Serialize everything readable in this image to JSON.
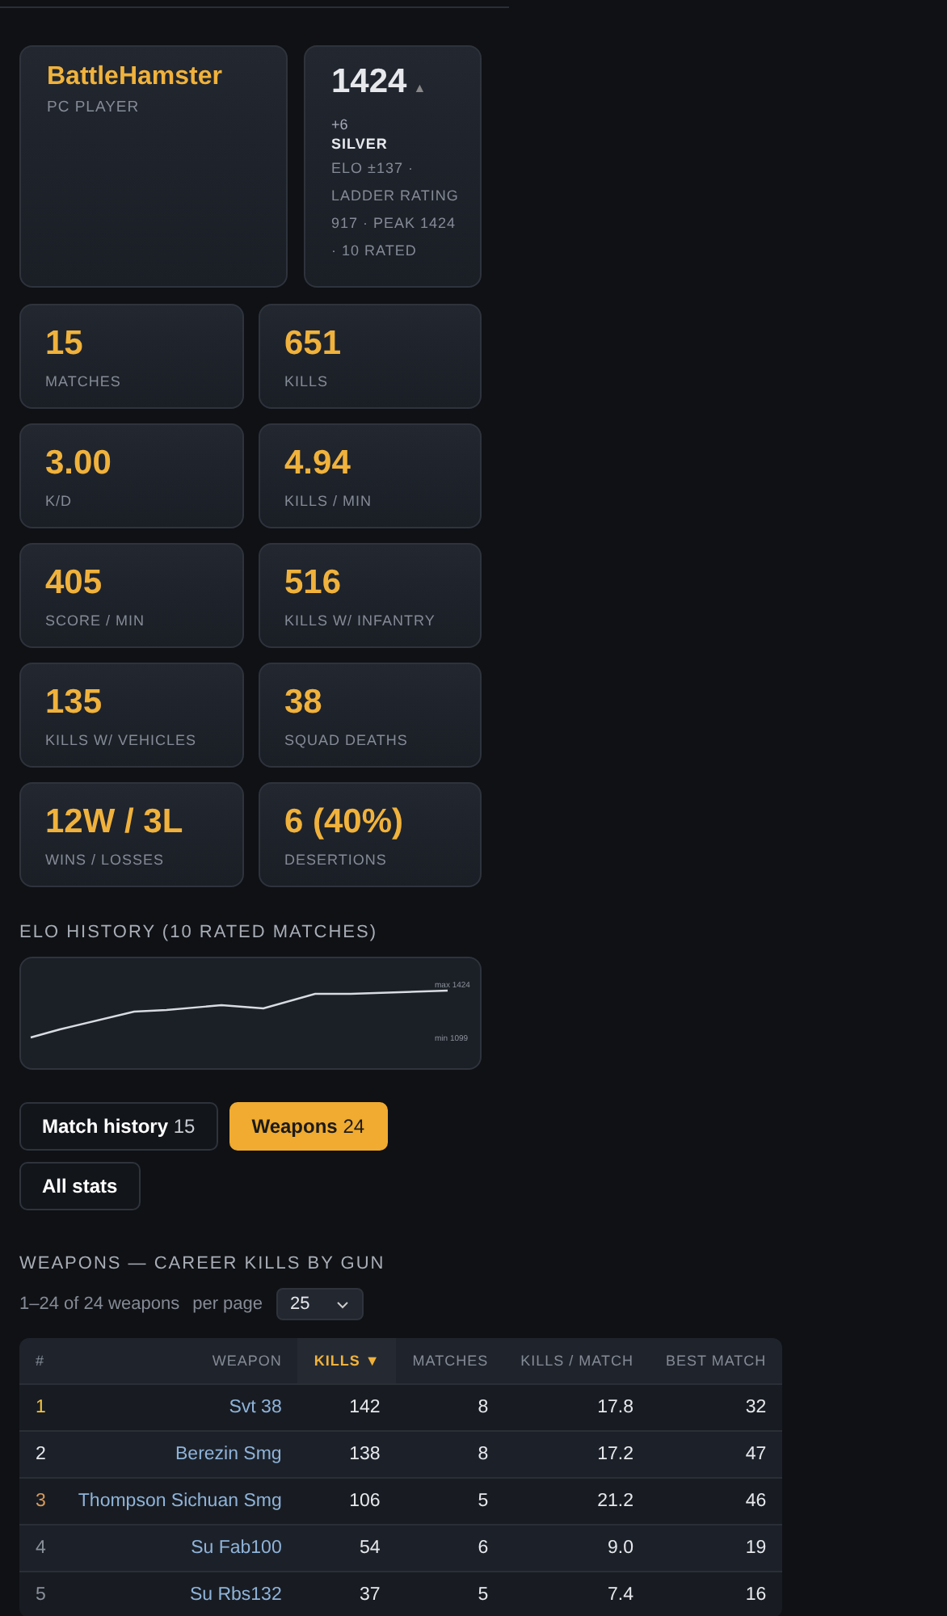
{
  "profile": {
    "name": "BattleHamster",
    "platform": "PC PLAYER"
  },
  "rating": {
    "elo": "1424",
    "trend_icon": "▲",
    "change": "+6",
    "tier": "SILVER",
    "details": "ELO ±137 · LADDER RATING 917 · PEAK 1424 · 10 RATED"
  },
  "stats": [
    {
      "value": "15",
      "label": "MATCHES"
    },
    {
      "value": "651",
      "label": "KILLS"
    },
    {
      "value": "3.00",
      "label": "K/D"
    },
    {
      "value": "4.94",
      "label": "KILLS / MIN"
    },
    {
      "value": "405",
      "label": "SCORE / MIN"
    },
    {
      "value": "516",
      "label": "KILLS W/ INFANTRY"
    },
    {
      "value": "135",
      "label": "KILLS W/ VEHICLES"
    },
    {
      "value": "38",
      "label": "SQUAD DEATHS"
    },
    {
      "value": "12W / 3L",
      "label": "WINS / LOSSES"
    },
    {
      "value": "6 (40%)",
      "label": "DESERTIONS"
    }
  ],
  "elo_history": {
    "title": "ELO HISTORY (10 RATED MATCHES)",
    "max_label": "max 1424",
    "min_label": "min 1099"
  },
  "tabs": [
    {
      "label": "Match history",
      "count": "15",
      "selected": false
    },
    {
      "label": "Weapons",
      "count": "24",
      "selected": true
    },
    {
      "label": "All stats",
      "selected": false
    }
  ],
  "weapons": {
    "title": "WEAPONS — CAREER KILLS BY GUN",
    "range": "1–24 of 24 weapons",
    "per_page_label": "per page",
    "per_page": "25",
    "columns": [
      {
        "label": "#",
        "sorted": false
      },
      {
        "label": "WEAPON",
        "sorted": false
      },
      {
        "label": "KILLS",
        "sorted": true,
        "sort_icon": "▼"
      },
      {
        "label": "MATCHES",
        "sorted": false
      },
      {
        "label": "KILLS / MATCH",
        "sorted": false
      },
      {
        "label": "BEST MATCH",
        "sorted": false
      }
    ],
    "rows": [
      {
        "rank": "1",
        "color": "#f5c542",
        "weapon": "Svt 38",
        "kills": "142",
        "matches": "8",
        "kills_per_match": "17.8",
        "best_match": "32"
      },
      {
        "rank": "2",
        "color": "#e6e8ec",
        "weapon": "Berezin Smg",
        "kills": "138",
        "matches": "8",
        "kills_per_match": "17.2",
        "best_match": "47"
      },
      {
        "rank": "3",
        "color": "#d99a5b",
        "weapon": "Thompson Sichuan Smg",
        "kills": "106",
        "matches": "5",
        "kills_per_match": "21.2",
        "best_match": "46"
      },
      {
        "rank": "4",
        "color": "#8a909a",
        "weapon": "Su Fab100",
        "kills": "54",
        "matches": "6",
        "kills_per_match": "9.0",
        "best_match": "19"
      },
      {
        "rank": "5",
        "color": "#8a909a",
        "weapon": "Su Rbs132",
        "kills": "37",
        "matches": "5",
        "kills_per_match": "7.4",
        "best_match": "16"
      }
    ]
  }
}
